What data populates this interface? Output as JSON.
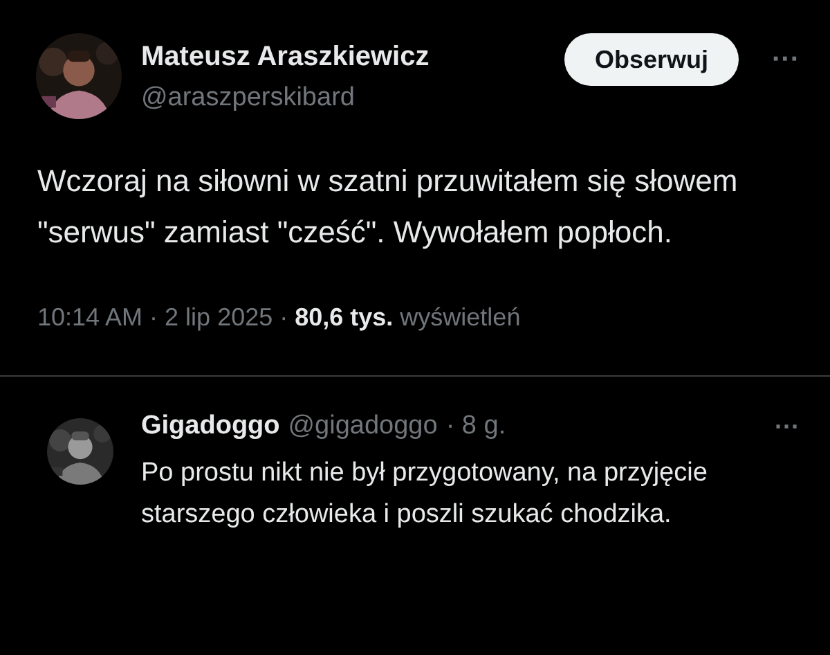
{
  "tweet": {
    "author": {
      "name": "Mateusz Araszkiewicz",
      "handle": "@araszperskibard"
    },
    "follow_button": "Obserwuj",
    "more": "···",
    "text": "Wczoraj na siłowni w szatni przuwitałem się słowem \"serwus\" zamiast \"cześć\". Wywołałem popłoch.",
    "meta": "10:14 AM · 2 lip 2025 · **80,6 tys.** wyświetleń"
  },
  "reply": {
    "author": {
      "name": "Gigadoggo",
      "handle": "@gigadoggo"
    },
    "time": "· 8 g.",
    "more": "···",
    "text": "Po prostu nikt nie był przygotowany, na przyjęcie starszego człowieka i poszli szukać chodzika."
  }
}
